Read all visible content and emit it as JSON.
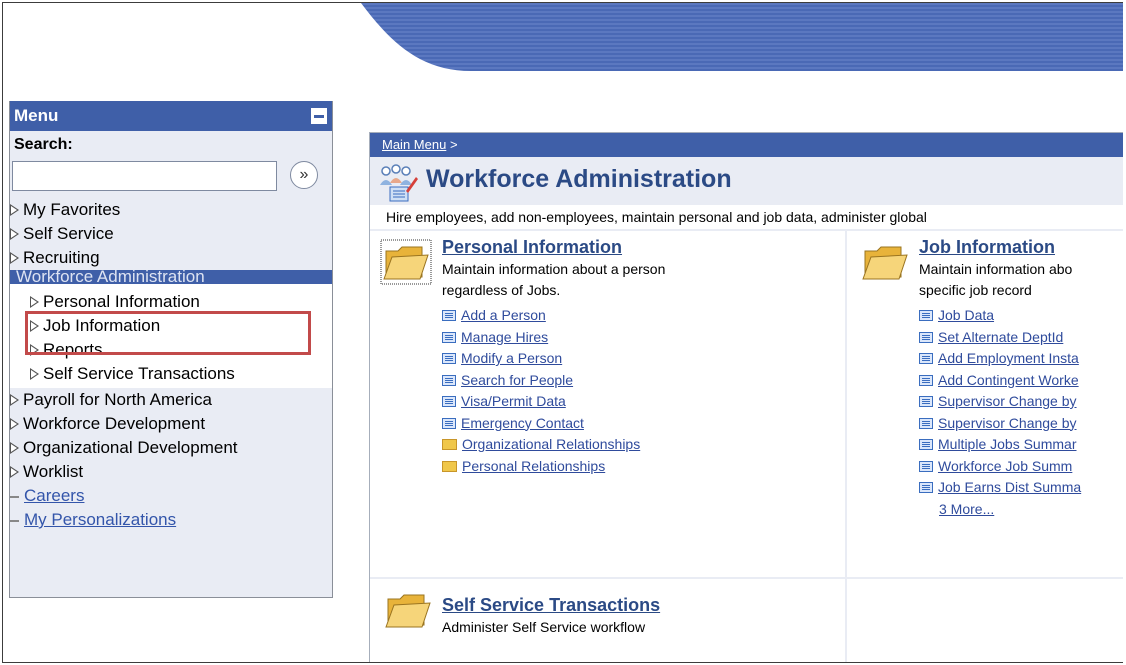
{
  "menu": {
    "title": "Menu",
    "search_label": "Search:",
    "search_value": "",
    "items": [
      {
        "label": "My Favorites"
      },
      {
        "label": "Self Service"
      },
      {
        "label": "Recruiting"
      },
      {
        "label": "Workforce Administration"
      }
    ],
    "sub_items": [
      {
        "label": "Personal Information"
      },
      {
        "label": "Job Information"
      },
      {
        "label": "Reports"
      },
      {
        "label": "Self Service Transactions"
      }
    ],
    "items_after": [
      {
        "label": "Payroll for North America"
      },
      {
        "label": "Workforce Development"
      },
      {
        "label": "Organizational Development"
      },
      {
        "label": "Worklist"
      }
    ],
    "links": [
      {
        "label": "Careers"
      },
      {
        "label": "My Personalizations"
      }
    ]
  },
  "main": {
    "breadcrumb_link": "Main Menu",
    "breadcrumb_sep": ">",
    "title": "Workforce Administration",
    "description": "Hire employees, add non-employees, maintain personal and job data, administer global",
    "sections": [
      {
        "title": "Personal Information",
        "desc_line1": "Maintain information about a person",
        "desc_line2": "regardless of Jobs.",
        "links": [
          {
            "label": "Add a Person",
            "kind": "page"
          },
          {
            "label": "Manage Hires",
            "kind": "page"
          },
          {
            "label": "Modify a Person",
            "kind": "page"
          },
          {
            "label": "Search for People",
            "kind": "page"
          },
          {
            "label": "Visa/Permit Data",
            "kind": "page"
          },
          {
            "label": "Emergency Contact",
            "kind": "page"
          },
          {
            "label": "Organizational Relationships",
            "kind": "folder"
          },
          {
            "label": "Personal Relationships",
            "kind": "folder"
          }
        ]
      },
      {
        "title": "Job Information",
        "desc_line1": "Maintain information abo",
        "desc_line2": "specific job record",
        "links": [
          {
            "label": "Job Data",
            "kind": "page"
          },
          {
            "label": "Set Alternate DeptId",
            "kind": "page"
          },
          {
            "label": "Add Employment Insta",
            "kind": "page"
          },
          {
            "label": "Add Contingent Worke",
            "kind": "page"
          },
          {
            "label": "Supervisor Change by",
            "kind": "page"
          },
          {
            "label": "Supervisor Change by",
            "kind": "page"
          },
          {
            "label": "Multiple Jobs Summar",
            "kind": "page"
          },
          {
            "label": "Workforce Job Summ",
            "kind": "page"
          },
          {
            "label": "Job Earns Dist Summa",
            "kind": "page"
          }
        ],
        "more": "3 More..."
      },
      {
        "title": "Self Service Transactions",
        "desc_line1": "Administer Self Service workflow"
      }
    ]
  },
  "colors": {
    "accent": "#3f5fa8",
    "link": "#2f4b9c",
    "highlight": "#c24a4a",
    "panel_bg": "#e9ecf4"
  }
}
